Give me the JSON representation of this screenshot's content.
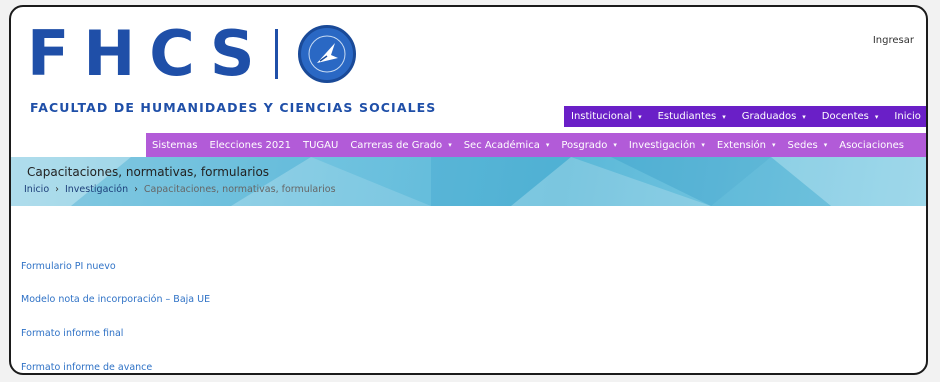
{
  "header": {
    "logo_text": "FHCS",
    "subtitle": "FACULTAD DE HUMANIDADES Y CIENCIAS SOCIALES",
    "login_label": "Ingresar"
  },
  "nav_primary": [
    {
      "label": "Institucional",
      "dropdown": true
    },
    {
      "label": "Estudiantes",
      "dropdown": true
    },
    {
      "label": "Graduados",
      "dropdown": true
    },
    {
      "label": "Docentes",
      "dropdown": true
    },
    {
      "label": "Inicio",
      "dropdown": false
    }
  ],
  "nav_secondary": [
    {
      "label": "Sistemas",
      "dropdown": false
    },
    {
      "label": "Elecciones 2021",
      "dropdown": false
    },
    {
      "label": "TUGAU",
      "dropdown": false
    },
    {
      "label": "Carreras de Grado",
      "dropdown": true
    },
    {
      "label": "Sec Académica",
      "dropdown": true
    },
    {
      "label": "Posgrado",
      "dropdown": true
    },
    {
      "label": "Investigación",
      "dropdown": true
    },
    {
      "label": "Extensión",
      "dropdown": true
    },
    {
      "label": "Sedes",
      "dropdown": true
    },
    {
      "label": "Asociaciones",
      "dropdown": false
    }
  ],
  "banner": {
    "title": "Capacitaciones, normativas, formularios",
    "breadcrumb": {
      "home": "Inicio",
      "parent": "Investigación",
      "current": "Capacitaciones, normativas, formularios"
    }
  },
  "documents": [
    {
      "label": "Formulario PI nuevo"
    },
    {
      "label": "Modelo nota de incorporación – Baja UE"
    },
    {
      "label": "Formato informe final"
    },
    {
      "label": "Formato informe de avance"
    }
  ],
  "colors": {
    "brand_blue": "#1f4fa8",
    "nav_primary_bg": "#6a1fc7",
    "nav_secondary_bg": "#b25bd8",
    "link_blue": "#2f72c6"
  },
  "icons": {
    "dropdown": "▾",
    "breadcrumb_separator": "›"
  }
}
